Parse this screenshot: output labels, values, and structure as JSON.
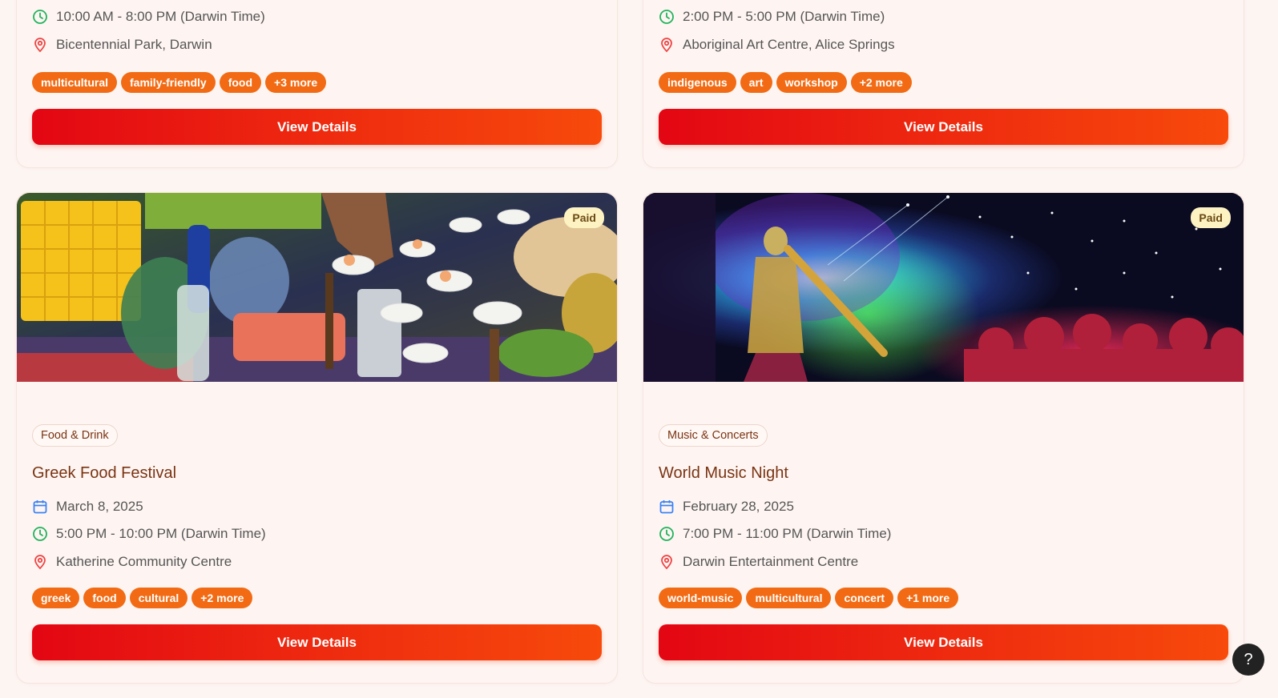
{
  "colors": {
    "accent": "#f26b14",
    "button_gradient_start": "#e30613",
    "button_gradient_end": "#f74a0b",
    "title": "#7a3413",
    "clock_icon": "#22b35e",
    "calendar_icon": "#3b82f6",
    "pin_icon": "#ef4444",
    "paid_badge_bg": "#fdf2c2"
  },
  "top_cards": [
    {
      "time": "10:00 AM - 8:00 PM (Darwin Time)",
      "location": "Bicentennial Park, Darwin",
      "tags": [
        "multicultural",
        "family-friendly",
        "food",
        "+3 more"
      ],
      "button_label": "View Details"
    },
    {
      "time": "2:00 PM - 5:00 PM (Darwin Time)",
      "location": "Aboriginal Art Centre, Alice Springs",
      "tags": [
        "indigenous",
        "art",
        "workshop",
        "+2 more"
      ],
      "button_label": "View Details"
    }
  ],
  "events": [
    {
      "badge": "Paid",
      "image_icon": "food-market-photo",
      "category": "Food & Drink",
      "title": "Greek Food Festival",
      "date": "March 8, 2025",
      "time": "5:00 PM - 10:00 PM (Darwin Time)",
      "location": "Katherine Community Centre",
      "tags": [
        "greek",
        "food",
        "cultural",
        "+2 more"
      ],
      "button_label": "View Details"
    },
    {
      "badge": "Paid",
      "image_icon": "concert-stage-photo",
      "category": "Music & Concerts",
      "title": "World Music Night",
      "date": "February 28, 2025",
      "time": "7:00 PM - 11:00 PM (Darwin Time)",
      "location": "Darwin Entertainment Centre",
      "tags": [
        "world-music",
        "multicultural",
        "concert",
        "+1 more"
      ],
      "button_label": "View Details"
    }
  ],
  "help_button": {
    "label": "?"
  }
}
